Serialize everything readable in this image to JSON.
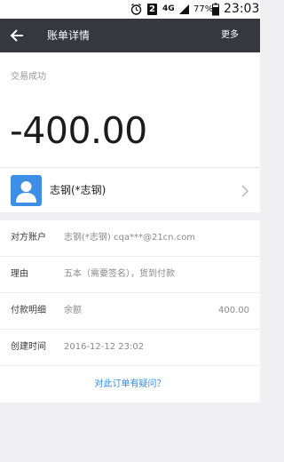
{
  "status_bar": {
    "alarm_icon": "alarm-clock-icon",
    "sim_label": "2",
    "network_label": "4G",
    "signal_icon": "signal-icon",
    "battery_percent": "77%",
    "battery_icon": "battery-icon",
    "time": "23:03"
  },
  "header": {
    "back_icon": "arrow-left-icon",
    "title": "账单详情",
    "more_label": "更多",
    "background_color": "#36373f"
  },
  "summary": {
    "status": "交易成功",
    "amount": "-400.00"
  },
  "payee": {
    "avatar_icon": "user-avatar-icon",
    "avatar_color": "#3d8ee6",
    "name": "志钢(*志钢)",
    "chevron_icon": "chevron-right-icon"
  },
  "details": {
    "counterparty_label": "对方账户",
    "counterparty_value": "志钢(*志钢) cqa***@21cn.com",
    "reason_label": "理由",
    "reason_value": "五本（需要签名），货到付款",
    "payment_label": "付款明细",
    "payment_method": "余额",
    "payment_amount": "400.00",
    "created_label": "创建时间",
    "created_value": "2016-12-12 23:02"
  },
  "help": {
    "question_link": "对此订单有疑问？",
    "link_color": "#2f8ae5"
  }
}
